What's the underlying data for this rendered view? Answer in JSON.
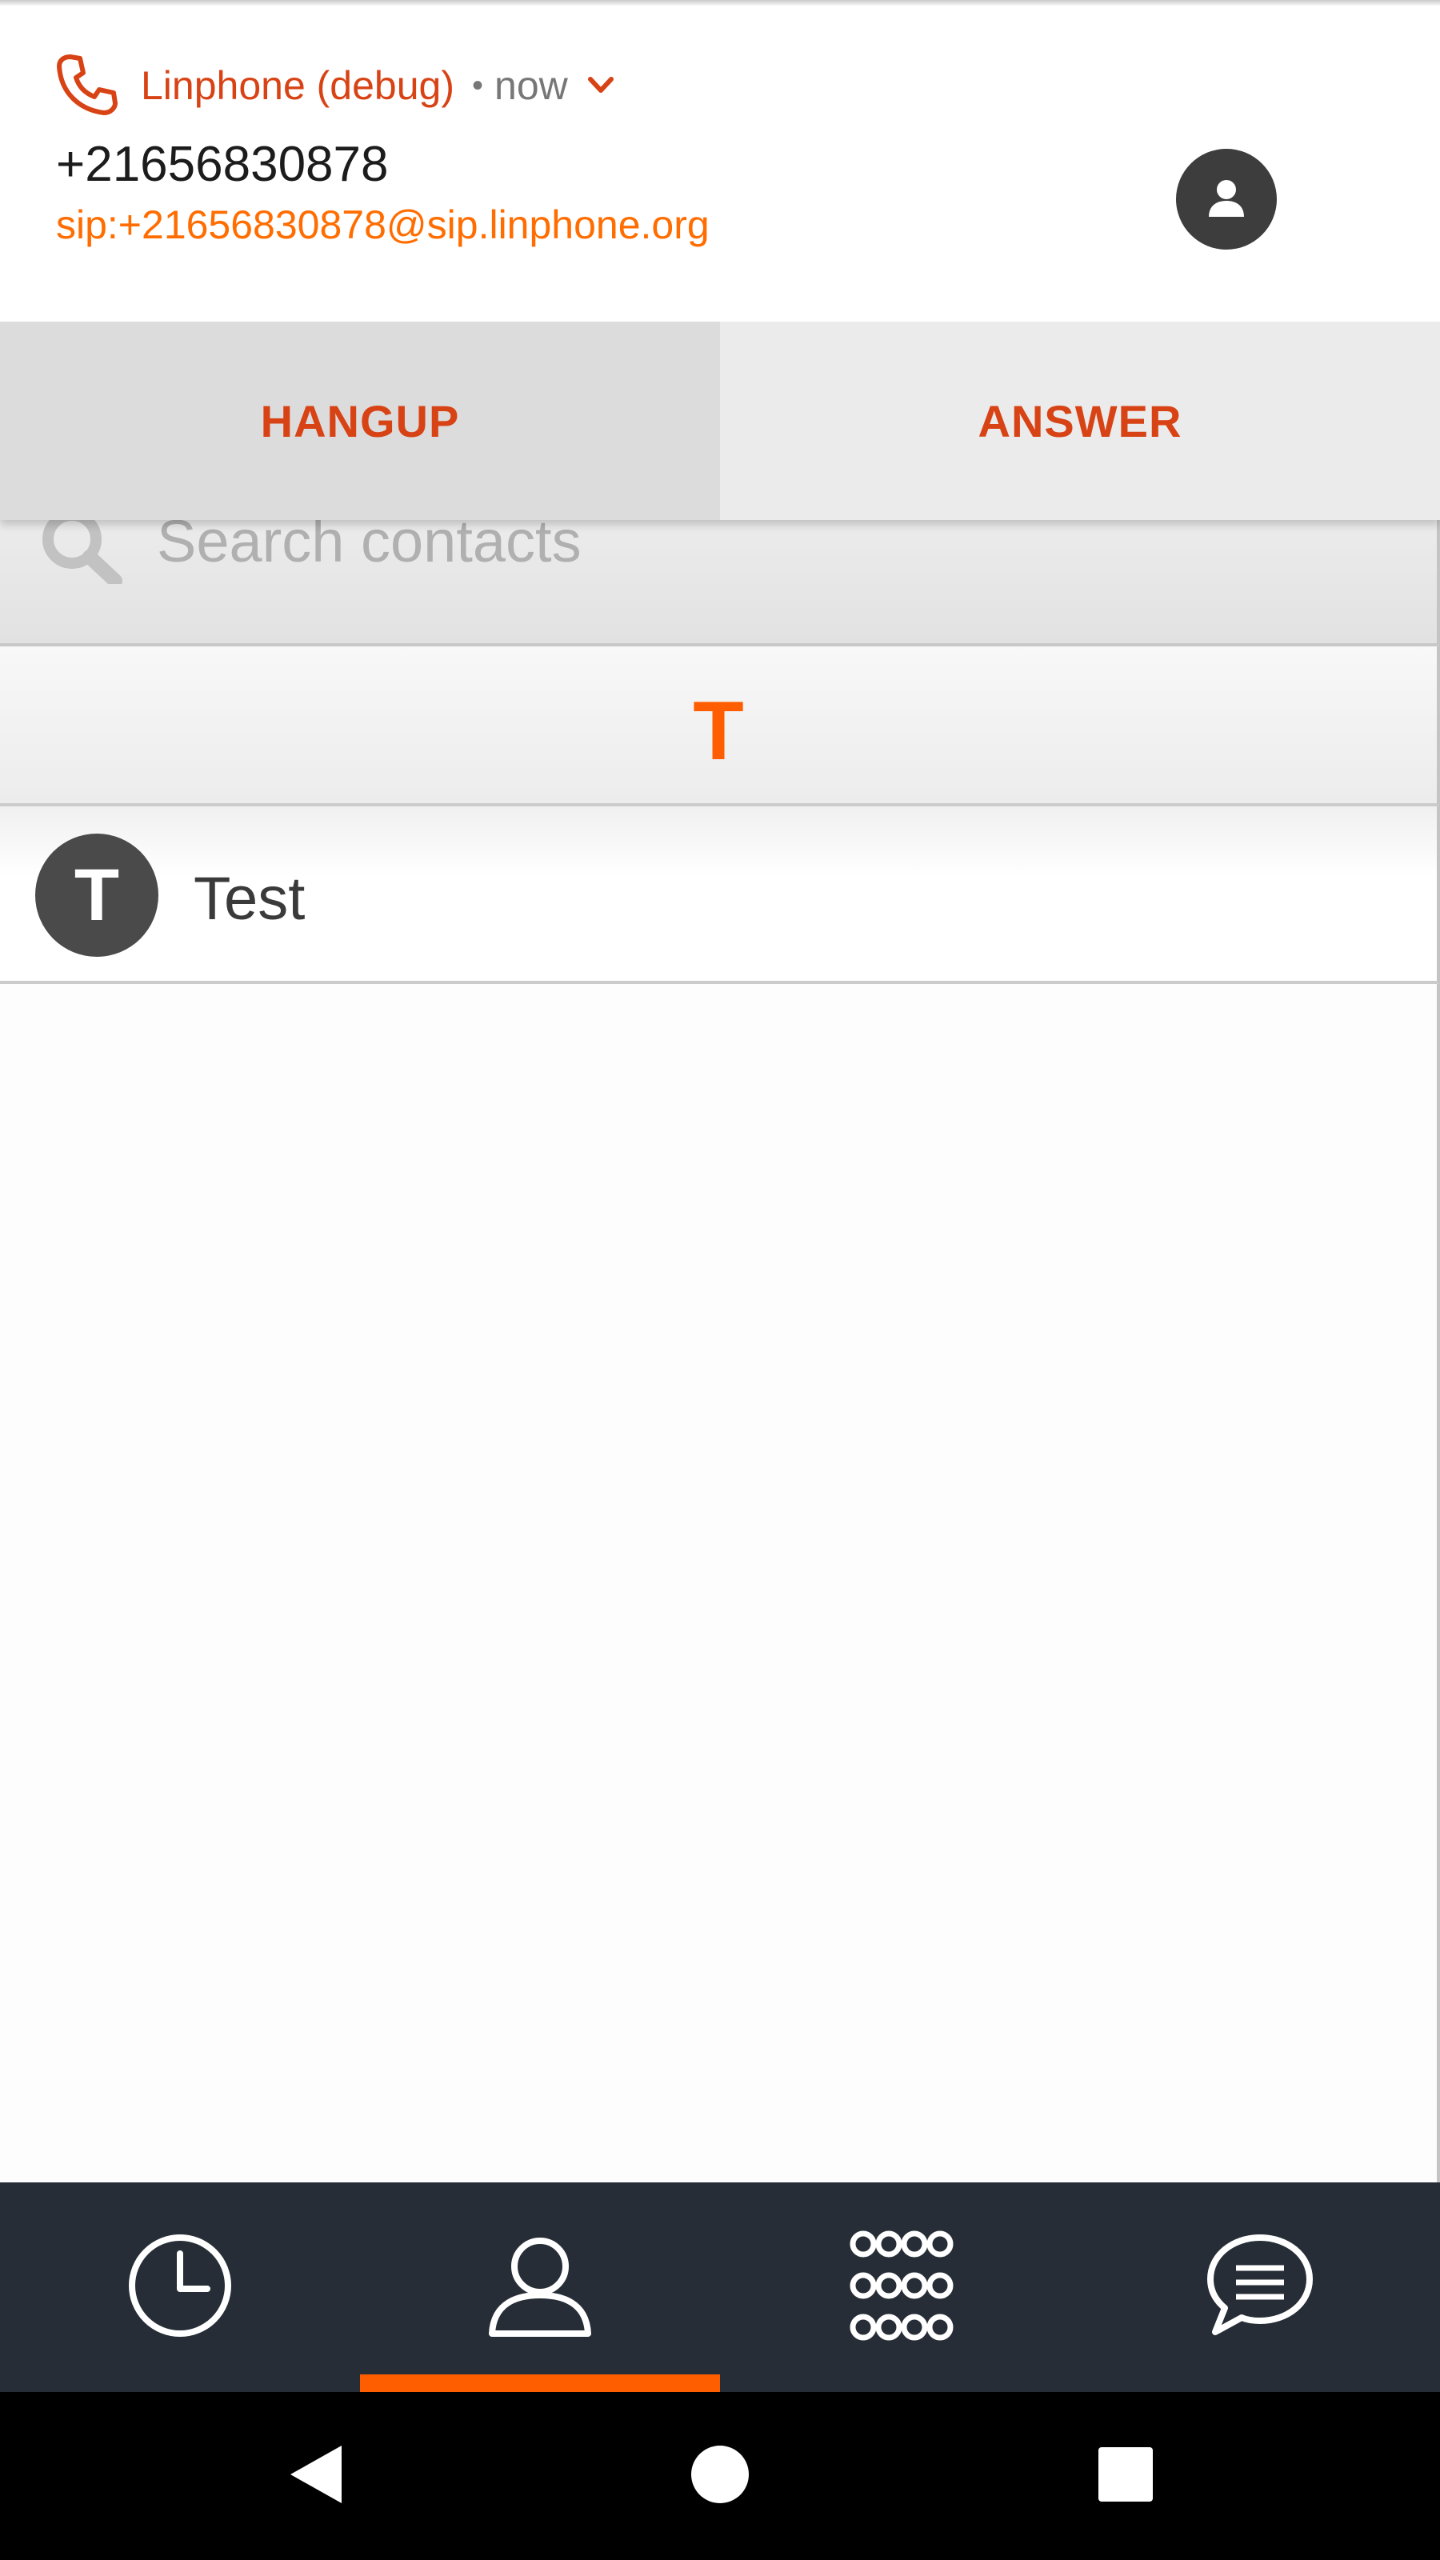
{
  "notification": {
    "app_name": "Linphone (debug)",
    "separator": "•",
    "time": "now",
    "caller_number": "+21656830878",
    "caller_sip": "sip:+21656830878@sip.linphone.org",
    "actions": {
      "hangup": "HANGUP",
      "answer": "ANSWER"
    },
    "icons": {
      "app": "phone-icon",
      "expand": "chevron-down-icon",
      "avatar": "person-icon"
    },
    "colors": {
      "accent": "#d84315",
      "sip": "#ff6d00"
    }
  },
  "search": {
    "placeholder": "Search contacts"
  },
  "contacts": {
    "section_letter": "T",
    "items": [
      {
        "initial": "T",
        "name": "Test"
      }
    ]
  },
  "tab_bar": {
    "tabs": [
      {
        "icon": "history-clock-icon",
        "active": false
      },
      {
        "icon": "contacts-person-icon",
        "active": true
      },
      {
        "icon": "dialpad-icon",
        "active": false
      },
      {
        "icon": "chat-bubble-icon",
        "active": false
      }
    ],
    "colors": {
      "background": "#262d36",
      "indicator": "#ff5e00"
    }
  },
  "system_nav": {
    "buttons": [
      "back-icon",
      "home-icon",
      "recents-icon"
    ]
  }
}
